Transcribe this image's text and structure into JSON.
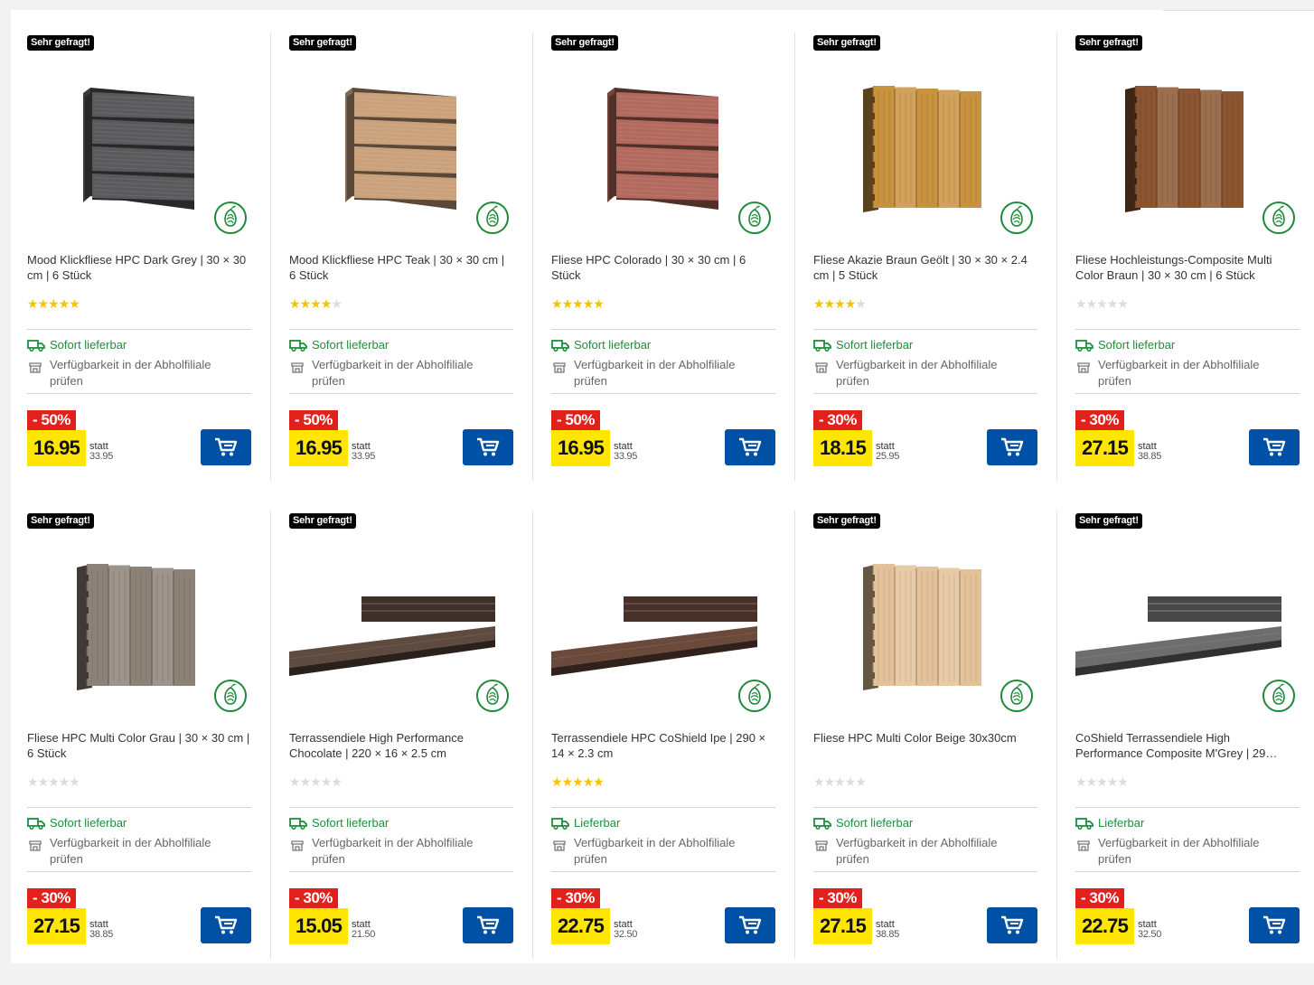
{
  "colors": {
    "badge": "#000000",
    "discount": "#e2211c",
    "price_bg": "#ffe600",
    "cart": "#0051a5",
    "available": "#1c8f3c",
    "star": "#f2c500"
  },
  "products": [
    {
      "badge": "Sehr gefragt!",
      "title": "Mood Klickfliese HPC Dark Grey | 30 × 30 cm | 6 Stück",
      "rating": 5,
      "availability": "Sofort lieferbar",
      "store_check": "Verfügbarkeit in der Abholfiliale prüfen",
      "discount": "- 50%",
      "price": "16.95",
      "statt_label": "statt",
      "old_price": "33.95",
      "image": "tile",
      "color": "#5a5a5c",
      "eco_icon": "eco-fingerprint-icon"
    },
    {
      "badge": "Sehr gefragt!",
      "title": "Mood Klickfliese HPC Teak | 30 × 30 cm | 6 Stück",
      "rating": 4,
      "availability": "Sofort lieferbar",
      "store_check": "Verfügbarkeit in der Abholfiliale prüfen",
      "discount": "- 50%",
      "price": "16.95",
      "statt_label": "statt",
      "old_price": "33.95",
      "image": "tile",
      "color": "#c9a27c",
      "eco_icon": "eco-fingerprint-icon"
    },
    {
      "badge": "Sehr gefragt!",
      "title": "Fliese HPC Colorado | 30 × 30 cm | 6 Stück",
      "rating": 5,
      "availability": "Sofort lieferbar",
      "store_check": "Verfügbarkeit in der Abholfiliale prüfen",
      "discount": "- 50%",
      "price": "16.95",
      "statt_label": "statt",
      "old_price": "33.95",
      "image": "tile",
      "color": "#b36a5e",
      "eco_icon": "eco-fingerprint-icon"
    },
    {
      "badge": "Sehr gefragt!",
      "title": "Fliese Akazie Braun Geölt | 30 × 30 × 2.4 cm | 5 Stück",
      "rating": 4,
      "availability": "Sofort lieferbar",
      "store_check": "Verfügbarkeit in der Abholfiliale prüfen",
      "discount": "- 30%",
      "price": "18.15",
      "statt_label": "statt",
      "old_price": "25.95",
      "image": "vtile",
      "color": "#c8923e",
      "eco_icon": "eco-fingerprint-icon"
    },
    {
      "badge": "Sehr gefragt!",
      "title": "Fliese Hochleistungs-Composite Multi Color Braun | 30 × 30 cm | 6 Stück",
      "rating": 0,
      "availability": "Sofort lieferbar",
      "store_check": "Verfügbarkeit in der Abholfiliale prüfen",
      "discount": "- 30%",
      "price": "27.15",
      "statt_label": "statt",
      "old_price": "38.85",
      "image": "vtile",
      "color": "#8a5530",
      "eco_icon": "eco-fingerprint-icon"
    },
    {
      "badge": "Sehr gefragt!",
      "title": "Fliese HPC Multi Color Grau | 30 × 30 cm | 6 Stück",
      "rating": 0,
      "availability": "Sofort lieferbar",
      "store_check": "Verfügbarkeit in der Abholfiliale prüfen",
      "discount": "- 30%",
      "price": "27.15",
      "statt_label": "statt",
      "old_price": "38.85",
      "image": "vtile",
      "color": "#8c8278",
      "eco_icon": "eco-fingerprint-icon"
    },
    {
      "badge": "Sehr gefragt!",
      "title": "Terrassendiele High Performance Chocolate | 220 × 16 × 2.5 cm",
      "rating": 0,
      "availability": "Sofort lieferbar",
      "store_check": "Verfügbarkeit in der Abholfiliale prüfen",
      "discount": "- 30%",
      "price": "15.05",
      "statt_label": "statt",
      "old_price": "21.50",
      "image": "plank",
      "color": "#5e4a3e",
      "eco_icon": "eco-fingerprint-icon"
    },
    {
      "badge": "",
      "title": "Terrassendiele HPC CoShield Ipe | 290 × 14 × 2.3 cm",
      "rating": 5,
      "availability": "Lieferbar",
      "store_check": "Verfügbarkeit in der Abholfiliale prüfen",
      "discount": "- 30%",
      "price": "22.75",
      "statt_label": "statt",
      "old_price": "32.50",
      "image": "plank",
      "color": "#6b4a3c",
      "eco_icon": "eco-fingerprint-icon"
    },
    {
      "badge": "Sehr gefragt!",
      "title": "Fliese HPC Multi Color Beige 30x30cm",
      "rating": 0,
      "availability": "Sofort lieferbar",
      "store_check": "Verfügbarkeit in der Abholfiliale prüfen",
      "discount": "- 30%",
      "price": "27.15",
      "statt_label": "statt",
      "old_price": "38.85",
      "image": "vtile",
      "color": "#e3c29a",
      "eco_icon": "eco-fingerprint-icon"
    },
    {
      "badge": "Sehr gefragt!",
      "title": "CoShield Terrassendiele High Performance Composite M'Grey | 29…",
      "rating": 0,
      "availability": "Lieferbar",
      "store_check": "Verfügbarkeit in der Abholfiliale prüfen",
      "discount": "- 30%",
      "price": "22.75",
      "statt_label": "statt",
      "old_price": "32.50",
      "image": "plank",
      "color": "#6d6d6d",
      "eco_icon": "eco-fingerprint-icon"
    }
  ]
}
